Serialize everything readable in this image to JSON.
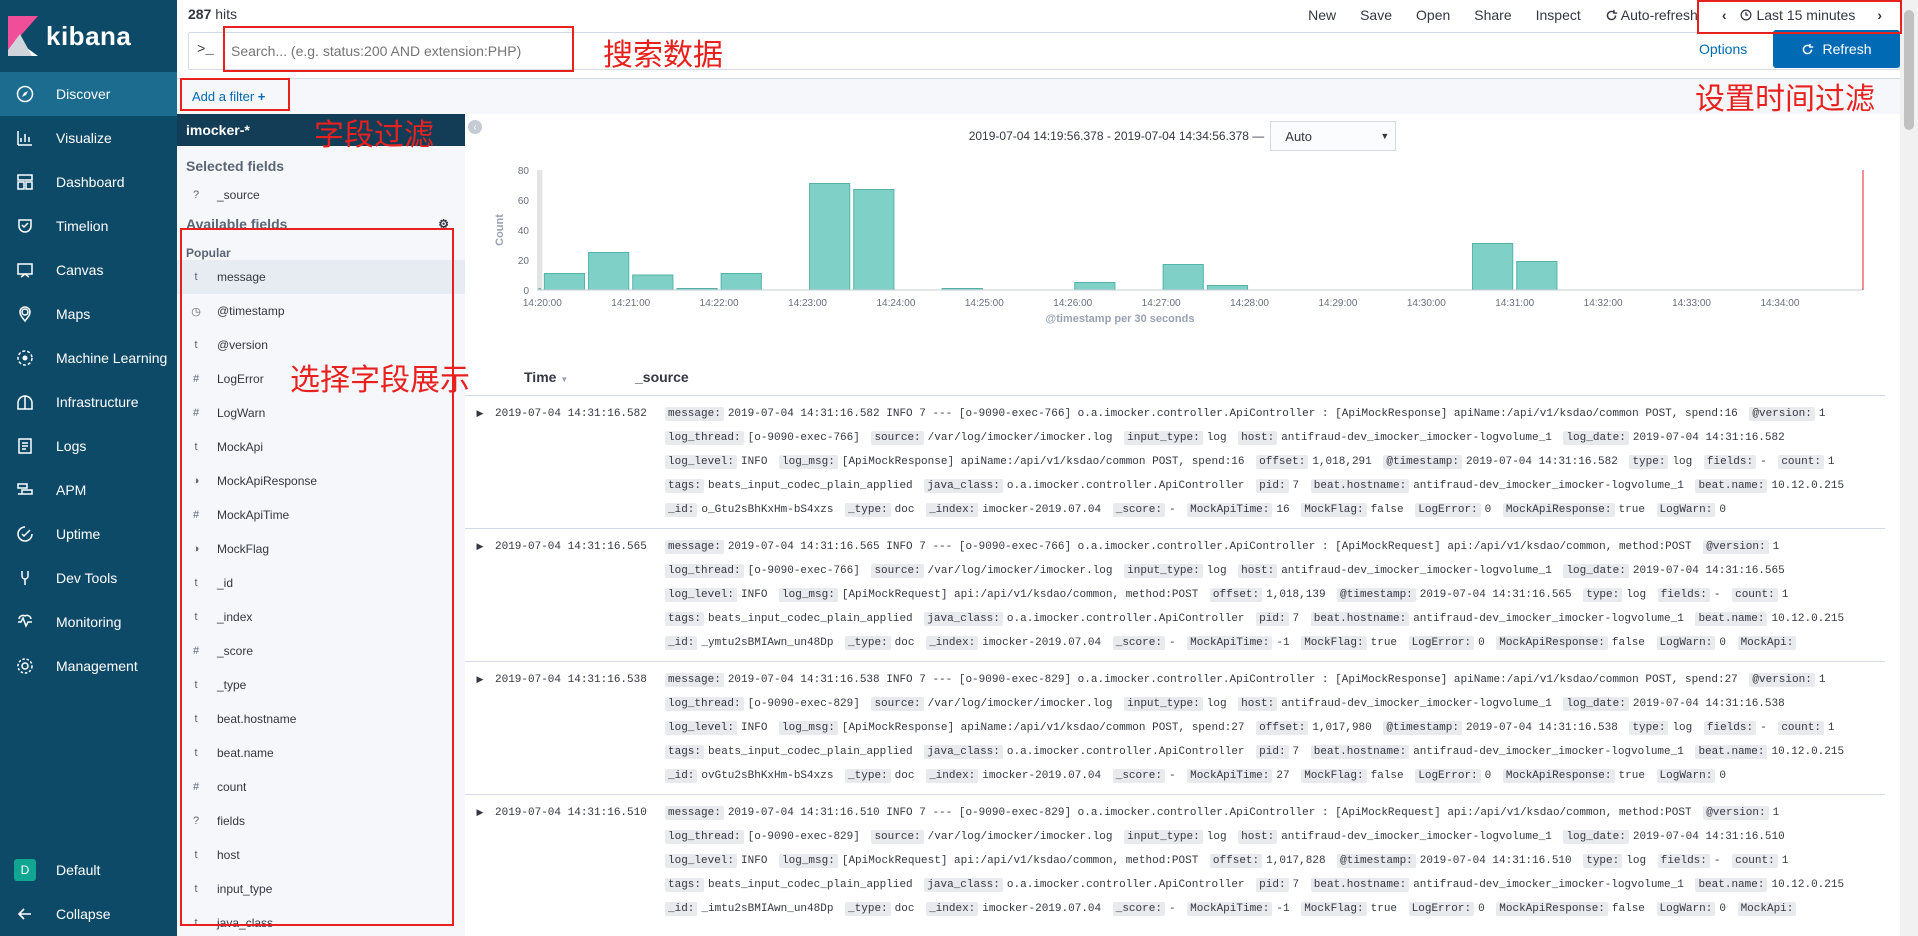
{
  "app": {
    "name": "kibana"
  },
  "sidebar": {
    "items": [
      {
        "label": "Discover",
        "icon": "compass-icon"
      },
      {
        "label": "Visualize",
        "icon": "visualize-icon"
      },
      {
        "label": "Dashboard",
        "icon": "dashboard-icon"
      },
      {
        "label": "Timelion",
        "icon": "timelion-icon"
      },
      {
        "label": "Canvas",
        "icon": "canvas-icon"
      },
      {
        "label": "Maps",
        "icon": "maps-icon"
      },
      {
        "label": "Machine Learning",
        "icon": "ml-icon"
      },
      {
        "label": "Infrastructure",
        "icon": "infrastructure-icon"
      },
      {
        "label": "Logs",
        "icon": "logs-icon"
      },
      {
        "label": "APM",
        "icon": "apm-icon"
      },
      {
        "label": "Uptime",
        "icon": "uptime-icon"
      },
      {
        "label": "Dev Tools",
        "icon": "devtools-icon"
      },
      {
        "label": "Monitoring",
        "icon": "monitoring-icon"
      },
      {
        "label": "Management",
        "icon": "gear-icon"
      }
    ],
    "space_badge": "D",
    "space_label": "Default",
    "collapse_label": "Collapse"
  },
  "topbar": {
    "hits_count": "287",
    "hits_label": "hits",
    "menu": [
      "New",
      "Save",
      "Open",
      "Share",
      "Inspect"
    ],
    "auto_refresh": "Auto-refresh",
    "time_range": "Last 15 minutes"
  },
  "search": {
    "prompt": ">_",
    "placeholder": "Search... (e.g. status:200 AND extension:PHP)",
    "options_label": "Options",
    "refresh_label": "Refresh"
  },
  "filter": {
    "add_label": "Add a filter"
  },
  "fields": {
    "index_pattern": "imocker-*",
    "selected_title": "Selected fields",
    "selected": [
      {
        "type": "?",
        "name": "_source"
      }
    ],
    "available_title": "Available fields",
    "popular_label": "Popular",
    "available": [
      {
        "type": "t",
        "name": "message"
      },
      {
        "type": "clock",
        "name": "@timestamp"
      },
      {
        "type": "t",
        "name": "@version"
      },
      {
        "type": "#",
        "name": "LogError"
      },
      {
        "type": "#",
        "name": "LogWarn"
      },
      {
        "type": "t",
        "name": "MockApi"
      },
      {
        "type": "bool",
        "name": "MockApiResponse"
      },
      {
        "type": "#",
        "name": "MockApiTime"
      },
      {
        "type": "bool",
        "name": "MockFlag"
      },
      {
        "type": "t",
        "name": "_id"
      },
      {
        "type": "t",
        "name": "_index"
      },
      {
        "type": "#",
        "name": "_score"
      },
      {
        "type": "t",
        "name": "_type"
      },
      {
        "type": "t",
        "name": "beat.hostname"
      },
      {
        "type": "t",
        "name": "beat.name"
      },
      {
        "type": "#",
        "name": "count"
      },
      {
        "type": "?",
        "name": "fields"
      },
      {
        "type": "t",
        "name": "host"
      },
      {
        "type": "t",
        "name": "input_type"
      },
      {
        "type": "t",
        "name": "java_class"
      }
    ]
  },
  "histogram": {
    "range_text": "2019-07-04 14:19:56.378 - 2019-07-04 14:34:56.378 —",
    "interval": "Auto"
  },
  "chart_data": {
    "type": "bar",
    "title": "",
    "xlabel": "@timestamp per 30 seconds",
    "ylabel": "Count",
    "ylim": [
      0,
      80
    ],
    "yticks": [
      0,
      20,
      40,
      60,
      80
    ],
    "xticks": [
      "14:20:00",
      "14:21:00",
      "14:22:00",
      "14:23:00",
      "14:24:00",
      "14:25:00",
      "14:26:00",
      "14:27:00",
      "14:28:00",
      "14:29:00",
      "14:30:00",
      "14:31:00",
      "14:32:00",
      "14:33:00",
      "14:34:00"
    ],
    "bar_color": "#7fd1c8",
    "bars": [
      {
        "x": "14:19:56",
        "value": 1
      },
      {
        "x": "14:20:00",
        "value": 11
      },
      {
        "x": "14:20:30",
        "value": 25
      },
      {
        "x": "14:21:00",
        "value": 10
      },
      {
        "x": "14:21:30",
        "value": 1
      },
      {
        "x": "14:22:00",
        "value": 11
      },
      {
        "x": "14:23:00",
        "value": 71
      },
      {
        "x": "14:23:30",
        "value": 67
      },
      {
        "x": "14:24:30",
        "value": 1
      },
      {
        "x": "14:26:00",
        "value": 5
      },
      {
        "x": "14:27:00",
        "value": 17
      },
      {
        "x": "14:27:30",
        "value": 3
      },
      {
        "x": "14:30:30",
        "value": 31
      },
      {
        "x": "14:31:00",
        "value": 19
      }
    ]
  },
  "table": {
    "col_time": "Time",
    "col_source": "_source",
    "rows": [
      {
        "time": "2019-07-04 14:31:16.582",
        "fields": [
          [
            "message:",
            "2019-07-04 14:31:16.582 INFO 7 --- [o-9090-exec-766] o.a.imocker.controller.ApiController : [ApiMockResponse] apiName:/api/v1/ksdao/common POST, spend:16"
          ],
          [
            "@version:",
            "1"
          ],
          [
            "log_thread:",
            "[o-9090-exec-766]"
          ],
          [
            "source:",
            "/var/log/imocker/imocker.log"
          ],
          [
            "input_type:",
            "log"
          ],
          [
            "host:",
            "antifraud-dev_imocker_imocker-logvolume_1"
          ],
          [
            "log_date:",
            "2019-07-04 14:31:16.582"
          ],
          [
            "log_level:",
            "INFO"
          ],
          [
            "log_msg:",
            "[ApiMockResponse] apiName:/api/v1/ksdao/common POST, spend:16"
          ],
          [
            "offset:",
            "1,018,291"
          ],
          [
            "@timestamp:",
            "2019-07-04 14:31:16.582"
          ],
          [
            "type:",
            "log"
          ],
          [
            "fields:",
            "-"
          ],
          [
            "count:",
            "1"
          ],
          [
            "tags:",
            "beats_input_codec_plain_applied"
          ],
          [
            "java_class:",
            "o.a.imocker.controller.ApiController"
          ],
          [
            "pid:",
            "7"
          ],
          [
            "beat.hostname:",
            "antifraud-dev_imocker_imocker-logvolume_1"
          ],
          [
            "beat.name:",
            "10.12.0.215"
          ],
          [
            "_id:",
            "o_Gtu2sBhKxHm-bS4xzs"
          ],
          [
            "_type:",
            "doc"
          ],
          [
            "_index:",
            "imocker-2019.07.04"
          ],
          [
            "_score:",
            "-"
          ],
          [
            "MockApiTime:",
            "16"
          ],
          [
            "MockFlag:",
            "false"
          ],
          [
            "LogError:",
            "0"
          ],
          [
            "MockApiResponse:",
            "true"
          ],
          [
            "LogWarn:",
            "0"
          ]
        ]
      },
      {
        "time": "2019-07-04 14:31:16.565",
        "fields": [
          [
            "message:",
            "2019-07-04 14:31:16.565 INFO 7 --- [o-9090-exec-766] o.a.imocker.controller.ApiController : [ApiMockRequest] api:/api/v1/ksdao/common, method:POST"
          ],
          [
            "@version:",
            "1"
          ],
          [
            "log_thread:",
            "[o-9090-exec-766]"
          ],
          [
            "source:",
            "/var/log/imocker/imocker.log"
          ],
          [
            "input_type:",
            "log"
          ],
          [
            "host:",
            "antifraud-dev_imocker_imocker-logvolume_1"
          ],
          [
            "log_date:",
            "2019-07-04 14:31:16.565"
          ],
          [
            "log_level:",
            "INFO"
          ],
          [
            "log_msg:",
            "[ApiMockRequest] api:/api/v1/ksdao/common, method:POST"
          ],
          [
            "offset:",
            "1,018,139"
          ],
          [
            "@timestamp:",
            "2019-07-04 14:31:16.565"
          ],
          [
            "type:",
            "log"
          ],
          [
            "fields:",
            "-"
          ],
          [
            "count:",
            "1"
          ],
          [
            "tags:",
            "beats_input_codec_plain_applied"
          ],
          [
            "java_class:",
            "o.a.imocker.controller.ApiController"
          ],
          [
            "pid:",
            "7"
          ],
          [
            "beat.hostname:",
            "antifraud-dev_imocker_imocker-logvolume_1"
          ],
          [
            "beat.name:",
            "10.12.0.215"
          ],
          [
            "_id:",
            "_ymtu2sBMIAwn_un48Dp"
          ],
          [
            "_type:",
            "doc"
          ],
          [
            "_index:",
            "imocker-2019.07.04"
          ],
          [
            "_score:",
            "-"
          ],
          [
            "MockApiTime:",
            "-1"
          ],
          [
            "MockFlag:",
            "true"
          ],
          [
            "LogError:",
            "0"
          ],
          [
            "MockApiResponse:",
            "false"
          ],
          [
            "LogWarn:",
            "0"
          ],
          [
            "MockApi:",
            ""
          ]
        ]
      },
      {
        "time": "2019-07-04 14:31:16.538",
        "fields": [
          [
            "message:",
            "2019-07-04 14:31:16.538 INFO 7 --- [o-9090-exec-829] o.a.imocker.controller.ApiController : [ApiMockResponse] apiName:/api/v1/ksdao/common POST, spend:27"
          ],
          [
            "@version:",
            "1"
          ],
          [
            "log_thread:",
            "[o-9090-exec-829]"
          ],
          [
            "source:",
            "/var/log/imocker/imocker.log"
          ],
          [
            "input_type:",
            "log"
          ],
          [
            "host:",
            "antifraud-dev_imocker_imocker-logvolume_1"
          ],
          [
            "log_date:",
            "2019-07-04 14:31:16.538"
          ],
          [
            "log_level:",
            "INFO"
          ],
          [
            "log_msg:",
            "[ApiMockResponse] apiName:/api/v1/ksdao/common POST, spend:27"
          ],
          [
            "offset:",
            "1,017,980"
          ],
          [
            "@timestamp:",
            "2019-07-04 14:31:16.538"
          ],
          [
            "type:",
            "log"
          ],
          [
            "fields:",
            "-"
          ],
          [
            "count:",
            "1"
          ],
          [
            "tags:",
            "beats_input_codec_plain_applied"
          ],
          [
            "java_class:",
            "o.a.imocker.controller.ApiController"
          ],
          [
            "pid:",
            "7"
          ],
          [
            "beat.hostname:",
            "antifraud-dev_imocker_imocker-logvolume_1"
          ],
          [
            "beat.name:",
            "10.12.0.215"
          ],
          [
            "_id:",
            "ovGtu2sBhKxHm-bS4xzs"
          ],
          [
            "_type:",
            "doc"
          ],
          [
            "_index:",
            "imocker-2019.07.04"
          ],
          [
            "_score:",
            "-"
          ],
          [
            "MockApiTime:",
            "27"
          ],
          [
            "MockFlag:",
            "false"
          ],
          [
            "LogError:",
            "0"
          ],
          [
            "MockApiResponse:",
            "true"
          ],
          [
            "LogWarn:",
            "0"
          ]
        ]
      },
      {
        "time": "2019-07-04 14:31:16.510",
        "fields": [
          [
            "message:",
            "2019-07-04 14:31:16.510 INFO 7 --- [o-9090-exec-829] o.a.imocker.controller.ApiController : [ApiMockRequest] api:/api/v1/ksdao/common, method:POST"
          ],
          [
            "@version:",
            "1"
          ],
          [
            "log_thread:",
            "[o-9090-exec-829]"
          ],
          [
            "source:",
            "/var/log/imocker/imocker.log"
          ],
          [
            "input_type:",
            "log"
          ],
          [
            "host:",
            "antifraud-dev_imocker_imocker-logvolume_1"
          ],
          [
            "log_date:",
            "2019-07-04 14:31:16.510"
          ],
          [
            "log_level:",
            "INFO"
          ],
          [
            "log_msg:",
            "[ApiMockRequest] api:/api/v1/ksdao/common, method:POST"
          ],
          [
            "offset:",
            "1,017,828"
          ],
          [
            "@timestamp:",
            "2019-07-04 14:31:16.510"
          ],
          [
            "type:",
            "log"
          ],
          [
            "fields:",
            "-"
          ],
          [
            "count:",
            "1"
          ],
          [
            "tags:",
            "beats_input_codec_plain_applied"
          ],
          [
            "java_class:",
            "o.a.imocker.controller.ApiController"
          ],
          [
            "pid:",
            "7"
          ],
          [
            "beat.hostname:",
            "antifraud-dev_imocker_imocker-logvolume_1"
          ],
          [
            "beat.name:",
            "10.12.0.215"
          ],
          [
            "_id:",
            "_imtu2sBMIAwn_un48Dp"
          ],
          [
            "_type:",
            "doc"
          ],
          [
            "_index:",
            "imocker-2019.07.04"
          ],
          [
            "_score:",
            "-"
          ],
          [
            "MockApiTime:",
            "-1"
          ],
          [
            "MockFlag:",
            "true"
          ],
          [
            "LogError:",
            "0"
          ],
          [
            "MockApiResponse:",
            "false"
          ],
          [
            "LogWarn:",
            "0"
          ],
          [
            "MockApi:",
            ""
          ]
        ]
      }
    ]
  },
  "annotations": {
    "search": "搜索数据",
    "time_filter": "设置时间过滤",
    "field_filter": "字段过滤",
    "field_select": "选择字段展示"
  },
  "colors": {
    "sidebar_bg": "#0d4a68",
    "accent": "#006bb4",
    "annotation": "#e8211f",
    "bar": "#7fd1c8"
  }
}
